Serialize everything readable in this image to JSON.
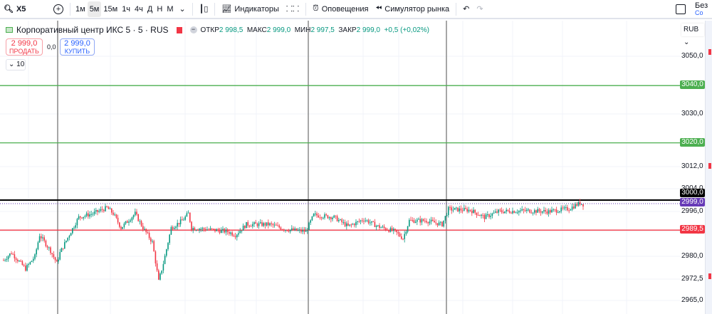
{
  "toolbar": {
    "symbol": "X5",
    "intervals": [
      "1м",
      "5м",
      "15м",
      "1ч",
      "4ч",
      "Д",
      "Н",
      "М"
    ],
    "active_interval": "5м",
    "indicators": "Индикаторы",
    "alerts": "Оповещения",
    "simulator": "Симулятор рынка",
    "right_label": "Без",
    "right_sub": "Co"
  },
  "legend": {
    "title": "Корпоративный центр ИКС 5 · 5 · RUS",
    "open_label": "ОТКР",
    "open": "2 998,5",
    "high_label": "МАКС",
    "high": "2 999,0",
    "low_label": "МИН",
    "low": "2 997,5",
    "close_label": "ЗАКР",
    "close": "2 999,0",
    "change": "+0,5 (+0,02%)"
  },
  "trade": {
    "sell_price": "2 999,0",
    "sell_label": "ПРОДАТЬ",
    "spread": "0,0",
    "buy_price": "2 999,0",
    "buy_label": "КУПИТЬ",
    "quantity": "10"
  },
  "currency": "RUB",
  "price_axis": {
    "labels": [
      "3050,0",
      "3030,0",
      "3012,0",
      "3004,0",
      "2996,0",
      "2988,0",
      "2980,0",
      "2972,5",
      "2965,0"
    ]
  },
  "price_tags": [
    {
      "value": "3040,0",
      "color": "#4caf50"
    },
    {
      "value": "3020,0",
      "color": "#4caf50"
    },
    {
      "value": "3000,0",
      "color": "#000000"
    },
    {
      "value": "2999,0",
      "color": "#673ab7"
    },
    {
      "value": "2989,5",
      "color": "#f23645"
    }
  ],
  "colors": {
    "up": "#089981",
    "down": "#f23645"
  },
  "chart_data": {
    "type": "candlestick",
    "level_lines": [
      3040,
      3020,
      3000,
      2989.5
    ],
    "last_price": 2999.0,
    "close_anchors": [
      [
        0,
        2979
      ],
      [
        5,
        2981.6
      ],
      [
        14,
        2976
      ],
      [
        20,
        2980.3
      ],
      [
        23,
        2987.8
      ],
      [
        30,
        2982.3
      ],
      [
        34,
        2977.9
      ],
      [
        36,
        2981.6
      ],
      [
        43,
        2989
      ],
      [
        48,
        2994
      ],
      [
        57,
        2995.3
      ],
      [
        66,
        2997.3
      ],
      [
        70,
        2995.3
      ],
      [
        75,
        2990.3
      ],
      [
        84,
        2995.3
      ],
      [
        89,
        2990.3
      ],
      [
        95,
        2985.3
      ],
      [
        99,
        2971.6
      ],
      [
        102,
        2977.9
      ],
      [
        107,
        2990.3
      ],
      [
        114,
        2992.8
      ],
      [
        118,
        2995.3
      ],
      [
        120,
        2990.3
      ],
      [
        130,
        2989.8
      ],
      [
        143,
        2989
      ],
      [
        148,
        2987.8
      ],
      [
        155,
        2991.5
      ],
      [
        170,
        2991.5
      ],
      [
        180,
        2989.8
      ],
      [
        193,
        2989
      ],
      [
        198,
        2994.8
      ],
      [
        211,
        2994
      ],
      [
        220,
        2990.8
      ],
      [
        230,
        2993.3
      ],
      [
        239,
        2990.8
      ],
      [
        250,
        2989
      ],
      [
        255,
        2986.6
      ],
      [
        259,
        2992.8
      ],
      [
        270,
        2992.8
      ],
      [
        280,
        2991.5
      ],
      [
        284,
        2996.8
      ],
      [
        298,
        2996.5
      ],
      [
        307,
        2994
      ],
      [
        316,
        2996
      ],
      [
        334,
        2996.3
      ],
      [
        348,
        2996
      ],
      [
        361,
        2997
      ],
      [
        368,
        2999
      ],
      [
        370,
        2998.5
      ]
    ]
  }
}
